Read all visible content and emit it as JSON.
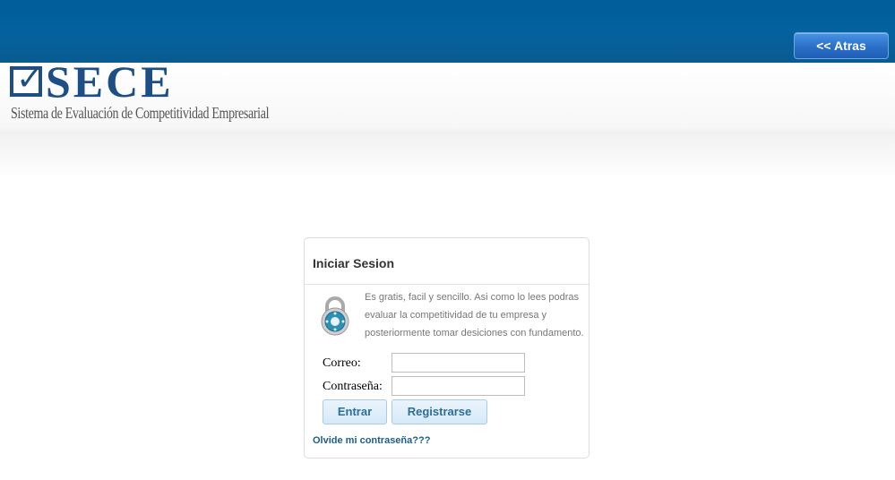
{
  "header": {
    "back_button": "<< Atras"
  },
  "logo": {
    "name": "SECE",
    "tagline": "Sistema de Evaluación de Competitividad Empresarial"
  },
  "login": {
    "title": "Iniciar Sesion",
    "intro": "Es gratis, facil y sencillo. Asi como lo lees podras evaluar la competitividad de tu empresa y posteriormente tomar desiciones con fundamento.",
    "email_label": "Correo:",
    "email_value": "",
    "password_label": "Contraseña:",
    "password_value": "",
    "submit_button": "Entrar",
    "register_button": "Registrarse",
    "forgot_link": "Olvide mi contraseña???",
    "icon": "lock-icon"
  },
  "colors": {
    "topbar": "#03629f",
    "logo_blue": "#1d4f86",
    "button_text": "#2d6e99",
    "link": "#1a5f8e"
  }
}
